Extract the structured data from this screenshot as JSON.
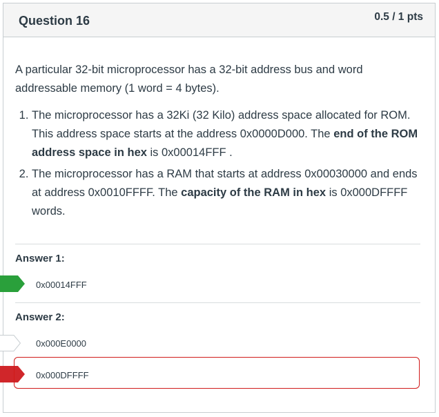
{
  "question": {
    "title": "Question 16",
    "points": "0.5 / 1 pts"
  },
  "body": {
    "intro": "A particular 32-bit microprocessor has a 32-bit address bus and word addressable memory (1 word = 4 bytes).",
    "items": [
      {
        "pre": "The microprocessor has a 32Ki (32 Kilo) address space allocated for ROM. This address space starts at the address 0x0000D000. The ",
        "bold": "end of the ROM address space in hex",
        "post": " is 0x00014FFF ."
      },
      {
        "pre": "The microprocessor has a RAM that starts at address 0x00030000 and ends at address 0x0010FFFF. The ",
        "bold": "capacity of the RAM in hex",
        "post": " is 0x000DFFFF words."
      }
    ]
  },
  "answers": [
    {
      "label": "Answer 1:",
      "given": "0x00014FFF",
      "status": "correct"
    },
    {
      "label": "Answer 2:",
      "correct_answer": "0x000E0000",
      "given": "0x000DFFFF",
      "status": "incorrect"
    }
  ],
  "colors": {
    "correct": "#2aa03b",
    "incorrect": "#d0262a",
    "correct_answer_marker": "#ffffff",
    "border": "#c7cdd1",
    "header_bg": "#f5f5f5",
    "text": "#2d3b45"
  },
  "icons": {
    "correct": "green-arrow-marker",
    "correct_answer": "white-arrow-marker",
    "incorrect": "red-arrow-marker"
  }
}
